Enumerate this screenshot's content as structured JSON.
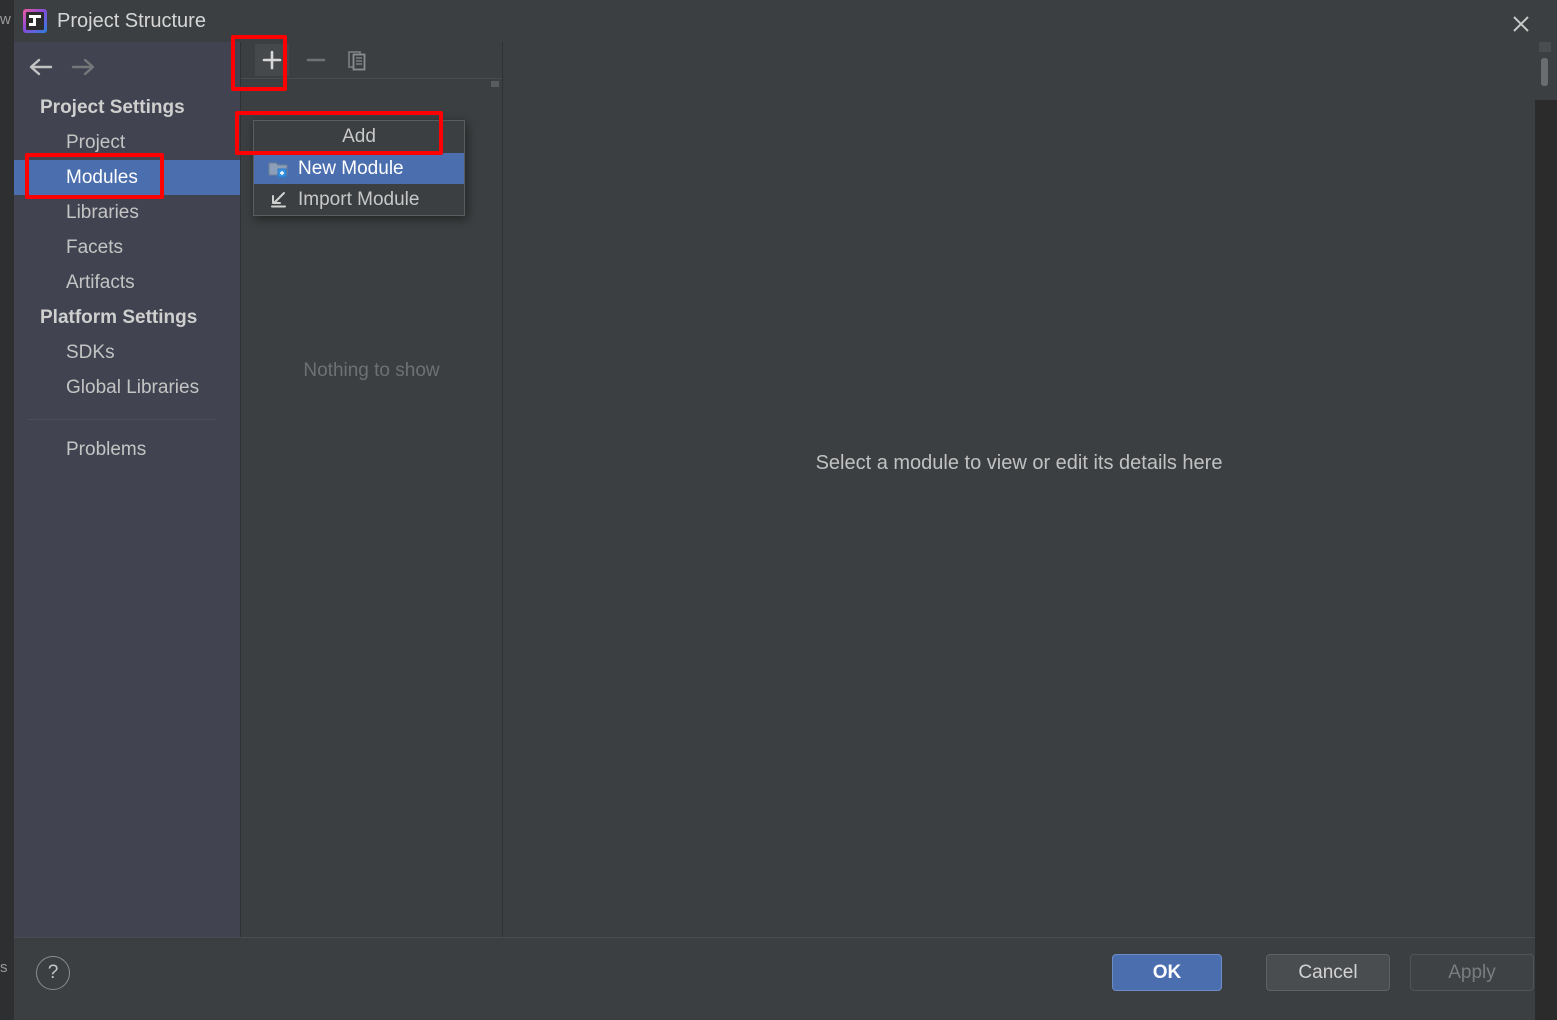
{
  "window": {
    "title": "Project Structure",
    "app_icon": "intellij-idea-icon",
    "close_icon": "close-icon",
    "behind_left_label": "w",
    "behind_left_label2": "s"
  },
  "sidebar": {
    "back_icon": "arrow-left-icon",
    "forward_icon": "arrow-right-icon",
    "groups": [
      {
        "label": "Project Settings",
        "items": [
          {
            "label": "Project",
            "selected": false
          },
          {
            "label": "Modules",
            "selected": true
          },
          {
            "label": "Libraries",
            "selected": false
          },
          {
            "label": "Facets",
            "selected": false
          },
          {
            "label": "Artifacts",
            "selected": false
          }
        ]
      },
      {
        "label": "Platform Settings",
        "items": [
          {
            "label": "SDKs",
            "selected": false
          },
          {
            "label": "Global Libraries",
            "selected": false
          }
        ]
      }
    ],
    "extra_items": [
      {
        "label": "Problems",
        "selected": false
      }
    ]
  },
  "module_panel": {
    "toolbar": {
      "add_icon": "plus-icon",
      "add_tooltip": "Add",
      "remove_icon": "minus-icon",
      "copy_icon": "copy-icon"
    },
    "empty_text": "Nothing to show"
  },
  "detail_panel": {
    "placeholder": "Select a module to view or edit its details here"
  },
  "add_menu": {
    "title": "Add",
    "items": [
      {
        "label": "New Module",
        "icon": "new-module-folder-icon",
        "highlighted": true
      },
      {
        "label": "Import Module",
        "icon": "import-module-icon",
        "highlighted": false
      }
    ]
  },
  "footer": {
    "help_label": "?",
    "ok_label": "OK",
    "cancel_label": "Cancel",
    "apply_label": "Apply"
  },
  "colors": {
    "dialog_background": "#3c3f41",
    "sidebar_background": "#414450",
    "selection_blue": "#4b6eaf",
    "annotation_red": "#ff0000",
    "text_primary": "#c8c8c8",
    "text_muted": "#6e7173"
  }
}
